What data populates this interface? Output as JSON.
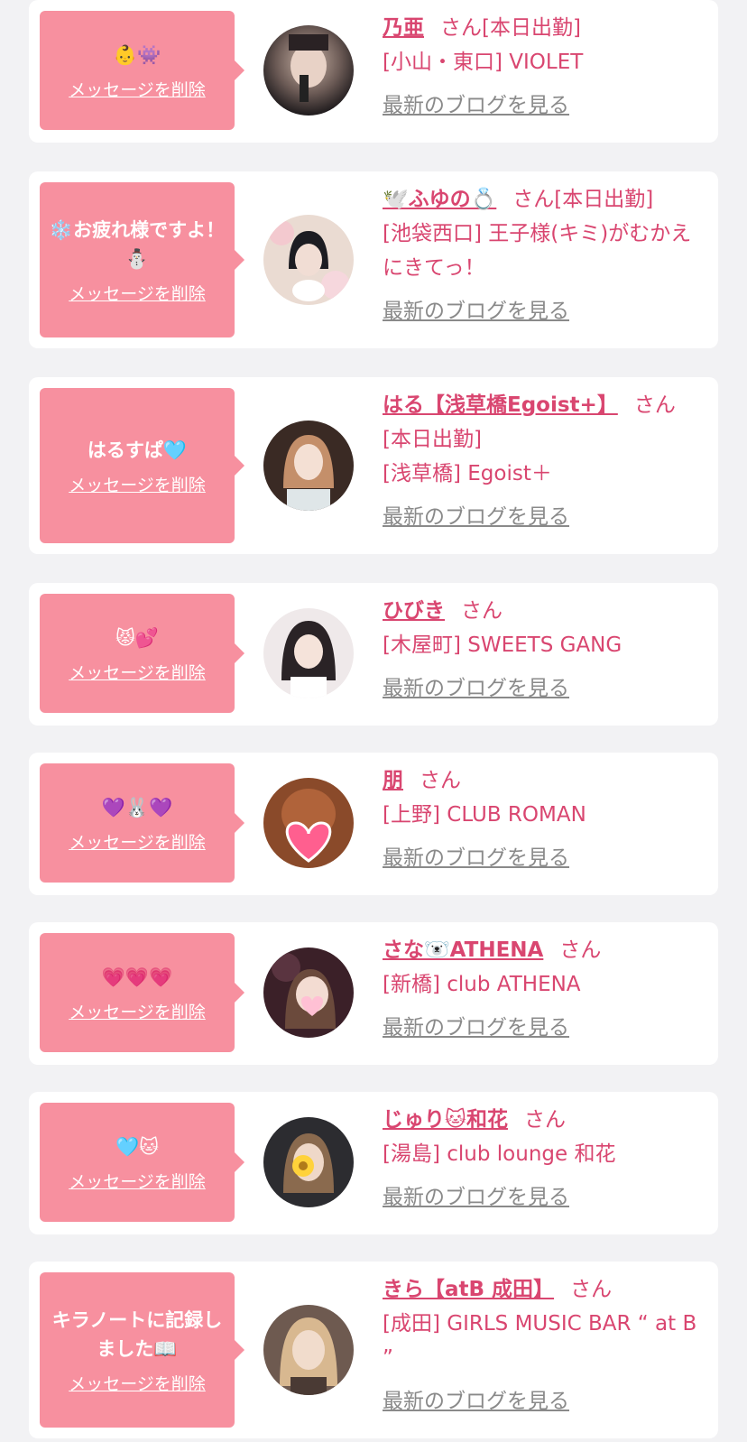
{
  "delete_label": "メッセージを削除",
  "blog_label": "最新のブログを見る",
  "san_label": "さん",
  "colors": {
    "accent": "#d94670",
    "bubble": "#f7909f",
    "background": "#f2f2f4",
    "link_gray": "#8a8a8a"
  },
  "cards": [
    {
      "message": "👶👾",
      "name": "乃亜",
      "status": "[本日出勤]",
      "shop": "[小山・東口] VIOLET"
    },
    {
      "message": "❄️お疲れ様ですよ！⛄",
      "name": "🕊️ふゆの💍",
      "status": "[本日出勤]",
      "shop": "[池袋西口] 王子様(キミ)がむかえにきてっ！"
    },
    {
      "message": "はるすぱ🩵",
      "name": "はる【浅草橋Egoist+】",
      "status": "[本日出勤]",
      "shop": "[浅草橋] Egoist＋"
    },
    {
      "message": "😾💕",
      "name": "ひびき",
      "status": "",
      "shop": "[木屋町] SWEETS GANG"
    },
    {
      "message": "💜🐰💜",
      "name": "朋",
      "status": "",
      "shop": "[上野] CLUB ROMAN"
    },
    {
      "message": "💗💗💗",
      "name": "さな🐻‍❄️ATHENA",
      "status": "",
      "shop": "[新橋] club ATHENA"
    },
    {
      "message": "🩵🐱",
      "name": "じゅり🐱和花",
      "status": "",
      "shop": "[湯島] club lounge 和花"
    },
    {
      "message": "キラノートに記録しました📖",
      "name": "きら【atB 成田】",
      "status": "",
      "shop": "[成田] GIRLS MUSIC BAR “ at B ”"
    }
  ]
}
